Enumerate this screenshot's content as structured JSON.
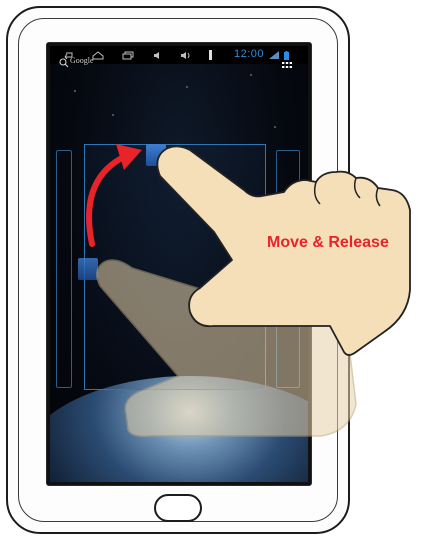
{
  "search": {
    "label": "Google",
    "icon": "search-icon"
  },
  "apps_icon": "apps-grid-icon",
  "status_bar": {
    "time": "12:00",
    "nav_icons": [
      "back-icon",
      "home-nav-icon",
      "recent-apps-icon",
      "volume-down-icon",
      "volume-up-icon",
      "menu-icon"
    ],
    "status_icons": [
      "wifi-icon",
      "battery-icon"
    ]
  },
  "gesture": {
    "instruction": "Move & Release",
    "arrow_color": "#e8232a",
    "hand_color": "#f5dfb8"
  },
  "colors": {
    "accent": "#2f76b5",
    "clock": "#2a8ee0",
    "instruction": "#e8232a"
  }
}
